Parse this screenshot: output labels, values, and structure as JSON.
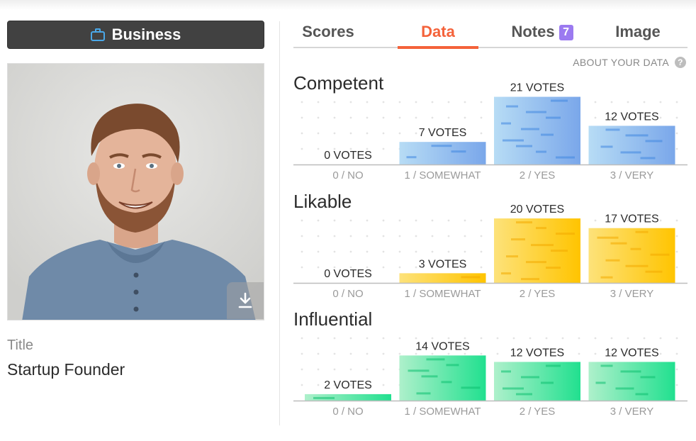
{
  "category": {
    "label": "Business",
    "icon": "briefcase-icon",
    "accent": "#4aa8e8"
  },
  "profile": {
    "title_label": "Title",
    "title_value": "Startup Founder"
  },
  "tabs": [
    {
      "label": "Scores"
    },
    {
      "label": "Data",
      "active": true
    },
    {
      "label": "Notes",
      "badge": "7"
    },
    {
      "label": "Image"
    }
  ],
  "about_link": "ABOUT YOUR DATA",
  "colors": {
    "active_tab": "#f4623a",
    "badge": "#9b7af0"
  },
  "chart_data": [
    {
      "type": "bar",
      "title": "Competent",
      "categories": [
        "0 / NO",
        "1 / SOMEWHAT",
        "2 / YES",
        "3 / VERY"
      ],
      "values": [
        0,
        7,
        21,
        12
      ],
      "value_labels": [
        "0 VOTES",
        "7 VOTES",
        "21 VOTES",
        "12 VOTES"
      ],
      "color_light": "#b7dcf5",
      "color_dark": "#7aa7ea",
      "color_accent": "#3f86e0"
    },
    {
      "type": "bar",
      "title": "Likable",
      "categories": [
        "0 / NO",
        "1 / SOMEWHAT",
        "2 / YES",
        "3 / VERY"
      ],
      "values": [
        0,
        3,
        20,
        17
      ],
      "value_labels": [
        "0 VOTES",
        "3 VOTES",
        "20 VOTES",
        "17 VOTES"
      ],
      "color_light": "#fde27a",
      "color_dark": "#ffc400",
      "color_accent": "#f2a900"
    },
    {
      "type": "bar",
      "title": "Influential",
      "categories": [
        "0 / NO",
        "1 / SOMEWHAT",
        "2 / YES",
        "3 / VERY"
      ],
      "values": [
        2,
        14,
        12,
        12
      ],
      "value_labels": [
        "2 VOTES",
        "14 VOTES",
        "12 VOTES",
        "12 VOTES"
      ],
      "color_light": "#aef0cb",
      "color_dark": "#21e08f",
      "color_accent": "#0dbf6f"
    }
  ]
}
